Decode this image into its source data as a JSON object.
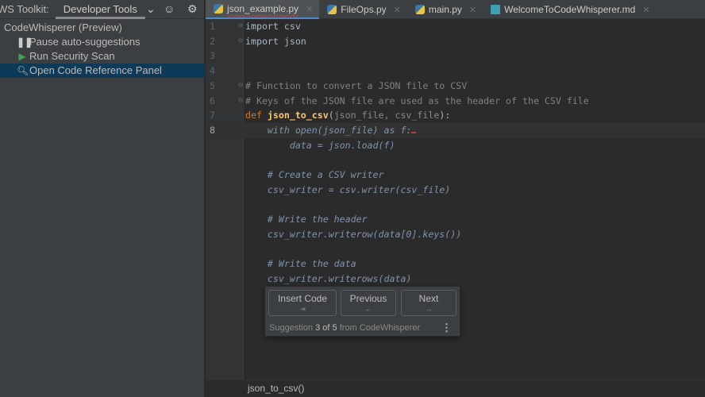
{
  "toolkit": {
    "title": "WS Toolkit:",
    "tab": "Developer Tools"
  },
  "tree": {
    "root": "CodeWhisperer (Preview)",
    "items": [
      {
        "label": "Pause auto-suggestions",
        "icon": "pause-icon"
      },
      {
        "label": "Run Security Scan",
        "icon": "play-icon"
      },
      {
        "label": "Open Code Reference Panel",
        "icon": "code-reference-icon"
      }
    ]
  },
  "tabs": [
    {
      "label": "json_example.py"
    },
    {
      "label": "FileOps.py"
    },
    {
      "label": "main.py"
    },
    {
      "label": "WelcomeToCodeWhisperer.md"
    }
  ],
  "line_numbers": [
    "1",
    "2",
    "3",
    "4",
    "5",
    "6",
    "7",
    "8"
  ],
  "code": {
    "l1": "import csv",
    "l2": "import json",
    "l5": "# Function to convert a JSON file to CSV",
    "l6": "# Keys of the JSON file are used as the header of the CSV file",
    "l7_kw": "def ",
    "l7_fn": "json_to_csv",
    "l7_a": "(",
    "l7_p": "json_file, csv_file",
    "l7_b": "):",
    "g8": "    with open(json_file) as f:",
    "g": [
      "        data = json.load(f)",
      "",
      "    # Create a CSV writer",
      "    csv_writer = csv.writer(csv_file)",
      "",
      "    # Write the header",
      "    csv_writer.writerow(data[0].keys())",
      "",
      "    # Write the data",
      "    csv_writer.writerows(data)"
    ]
  },
  "popup": {
    "insert": "Insert Code",
    "insert_key": "⇥",
    "previous": "Previous",
    "previous_key": "←",
    "next": "Next",
    "next_key": "→",
    "s1": "Suggestion ",
    "current": "3 of 5",
    "s2": " from CodeWhisperer"
  },
  "breadcrumb": "json_to_csv()"
}
